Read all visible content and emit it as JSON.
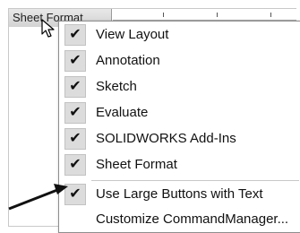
{
  "tab": {
    "label": "Sheet Format"
  },
  "menu": {
    "items": [
      {
        "label": "View Layout",
        "checked": true
      },
      {
        "label": "Annotation",
        "checked": true
      },
      {
        "label": "Sketch",
        "checked": true
      },
      {
        "label": "Evaluate",
        "checked": true
      },
      {
        "label": "SOLIDWORKS Add-Ins",
        "checked": true
      },
      {
        "label": "Sheet Format",
        "checked": true
      },
      {
        "label": "Use Large Buttons with Text",
        "checked": true
      },
      {
        "label": "Customize CommandManager...",
        "checked": false
      }
    ],
    "check_glyph": "✔"
  },
  "icons": {
    "cursor": "arrow-pointer-icon",
    "callout": "callout-arrow"
  },
  "colors": {
    "check_bg": "#dcdcdc",
    "menu_bg": "#ffffff",
    "tab_bg": "#d8d8d8"
  }
}
